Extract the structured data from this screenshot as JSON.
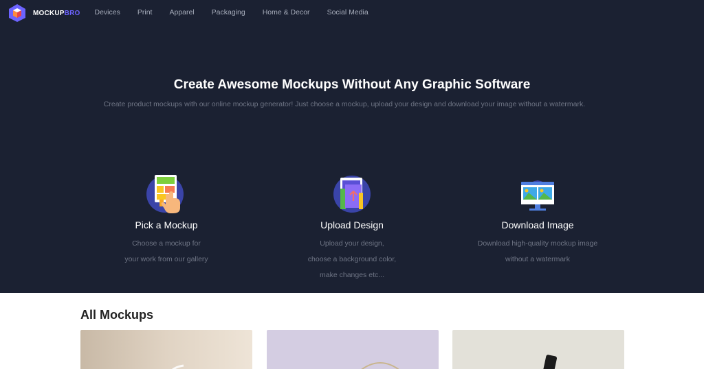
{
  "brand": {
    "name_part1": "MOCKUP",
    "name_part2": "BRO"
  },
  "nav": {
    "items": [
      {
        "label": "Devices"
      },
      {
        "label": "Print"
      },
      {
        "label": "Apparel"
      },
      {
        "label": "Packaging"
      },
      {
        "label": "Home & Decor"
      },
      {
        "label": "Social Media"
      }
    ]
  },
  "hero": {
    "title": "Create Awesome Mockups Without Any Graphic Software",
    "subtitle": "Create product mockups with our online mockup generator! Just choose a mockup, upload your design and download your image without a watermark."
  },
  "steps": [
    {
      "icon": "pick-mockup-icon",
      "title": "Pick a Mockup",
      "desc": [
        "Choose a mockup for",
        "your work from our gallery"
      ]
    },
    {
      "icon": "upload-design-icon",
      "title": "Upload Design",
      "desc": [
        "Upload your design,",
        "choose a background color,",
        "make changes etc..."
      ]
    },
    {
      "icon": "download-image-icon",
      "title": "Download Image",
      "desc": [
        "Download high-quality mockup image",
        "without a watermark"
      ]
    }
  ],
  "mockups_section": {
    "title": "All Mockups"
  },
  "colors": {
    "hero_bg": "#1b2132",
    "accent": "#6c63ff",
    "nav_text": "#a7adbb",
    "muted_text": "#6f7585"
  }
}
